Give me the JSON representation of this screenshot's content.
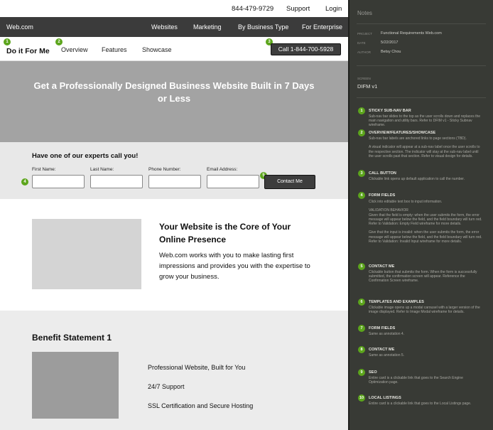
{
  "utility_bar": {
    "phone": "844-479-9729",
    "support": "Support",
    "login": "Login"
  },
  "main_nav": {
    "logo": "Web.com",
    "items": [
      "Websites",
      "Marketing",
      "By Business Type",
      "For Enterprise"
    ]
  },
  "sub_nav": {
    "brand": "Do it For Me",
    "links": [
      "Overview",
      "Features",
      "Showcase"
    ],
    "call_button": "Call 1-844-700-5928"
  },
  "hero": {
    "headline": "Get a Professionally Designed Business Website Built in 7 Days or Less"
  },
  "callback_form": {
    "title": "Have one of our experts call you!",
    "fields": [
      {
        "label": "First Name:",
        "value": ""
      },
      {
        "label": "Last Name:",
        "value": ""
      },
      {
        "label": "Phone Number:",
        "value": ""
      },
      {
        "label": "Email Address:",
        "value": ""
      }
    ],
    "submit": "Contact Me"
  },
  "about": {
    "heading": "Your Website is the Core of Your Online Presence",
    "body": "Web.com works with you to make lasting first impressions and provides you with the expertise to grow your business."
  },
  "benefit": {
    "heading": "Benefit Statement 1",
    "items": [
      "Professional Website, Built for You",
      "24/7 Support",
      "SSL Certification and Secure Hosting"
    ]
  },
  "badges": [
    "1",
    "2",
    "3",
    "4",
    "5"
  ],
  "notes": {
    "title": "Notes",
    "meta": [
      {
        "key": "PROJECT",
        "value": "Functional Requirements Web.com"
      },
      {
        "key": "DATE",
        "value": "5/22/2017"
      },
      {
        "key": "AUTHOR",
        "value": "Betsy Chou"
      }
    ],
    "screen_key": "SCREEN",
    "screen_value": "DIFM v1",
    "annotations": [
      {
        "num": "1",
        "title": "STICKY SUB-NAV BAR",
        "text": "Sub-nav bar slides to the top as the user scrolls down and replaces the main navigation and utility bars. Refer to DFIM v1 - Sticky Subnav wireframe."
      },
      {
        "num": "2",
        "title": "OVERVIEW/FEATURES/SHOWCASE",
        "text": "Sub-nav bar labels are anchored links to page sections (TBD).\n\nA visual indicator will appear at a sub-nav label once the user scrolls to the respective section. The indicator will stay at the sub-nav label until the user scrolls past that section. Refer to visual design for details."
      },
      {
        "num": "3",
        "title": "CALL BUTTON",
        "text": "Clickable link opens up default application to call the number."
      },
      {
        "num": "4",
        "title": "FORM FIELDS",
        "text": "Click into editable text box to input information.\n\nVALIDATION BEHAVIOR\nGiven that the field is empty: when the user submits the form, the error message will appear below the field, and the field boundary will turn red. Refer to Validation: Empty Field wireframe for more details.\n\nGive that the input is invalid: when the user submits the form, the error message will appear below the field, and the field boundary will turn red. Refer to Validation: Invalid Input wireframe for more details."
      },
      {
        "num": "5",
        "title": "CONTACT ME",
        "text": "Clickable button that submits the form. When the form is successfully submitted, the confirmation screen will appear. Reference the Confirmation Screen wireframe."
      },
      {
        "num": "6",
        "title": "TEMPLATES AND EXAMPLES",
        "text": "Clickable image opens up a modal carousel with a larger version of the image displayed. Refer to Image Modal wireframe for details."
      },
      {
        "num": "7",
        "title": "FORM FIELDS",
        "text": "Same as annotation 4."
      },
      {
        "num": "8",
        "title": "CONTACT ME",
        "text": "Same as annotation 5."
      },
      {
        "num": "9",
        "title": "SEO",
        "text": "Entire card is a clickable link that goes to the Search Engine Optimization page."
      },
      {
        "num": "10",
        "title": "LOCAL LISTINGS",
        "text": "Entire card is a clickable link that goes to the Local Listings page."
      }
    ]
  },
  "colors": {
    "accent_green": "#5ca51c",
    "nav_dark": "#3b3b3b",
    "notes_bg": "#383a35"
  }
}
